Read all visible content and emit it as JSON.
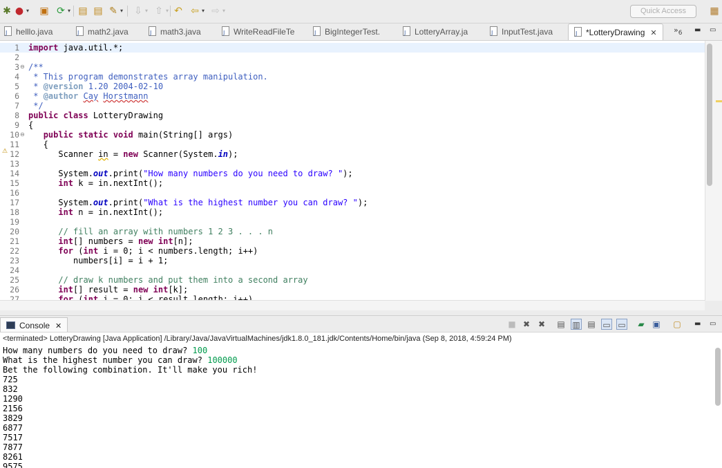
{
  "toolbar": {
    "icons": [
      "debug-icon",
      "run-icon",
      "new-package-icon",
      "coverage-icon",
      "open-type-icon",
      "open-task-icon",
      "annotation-icon",
      "next-annotation-icon",
      "previous-annotation-icon",
      "back-icon",
      "forward-icon"
    ],
    "quick_access_placeholder": "Quick Access",
    "perspective_icon": "java-perspective-icon"
  },
  "tabs": [
    {
      "label": "helllo.java"
    },
    {
      "label": "math2.java"
    },
    {
      "label": "math3.java"
    },
    {
      "label": "WriteReadFileTe"
    },
    {
      "label": "BigIntegerTest."
    },
    {
      "label": "LotteryArray.ja"
    },
    {
      "label": "InputTest.java"
    },
    {
      "label": "*LotteryDrawing",
      "active": true
    }
  ],
  "tabs_overflow": "»",
  "tabs_overflow_count": "6",
  "editor": {
    "lines": [
      {
        "n": "1",
        "html": "<span class=\"kw\">import</span> java.util.*;"
      },
      {
        "n": "2",
        "html": ""
      },
      {
        "n": "3",
        "html": "<span class=\"jd\">/**</span>"
      },
      {
        "n": "4",
        "html": "<span class=\"jd\"> * This program demonstrates array manipulation.</span>"
      },
      {
        "n": "5",
        "html": "<span class=\"jd\"> * </span><span class=\"jdtag\">@version</span><span class=\"jd\"> 1.20 2004-02-10</span>"
      },
      {
        "n": "6",
        "html": "<span class=\"jd\"> * </span><span class=\"jdtag\">@author</span><span class=\"jd\"> <span class=\"sqr\">Cay</span> <span class=\"sqr\">Horstmann</span></span>"
      },
      {
        "n": "7",
        "html": "<span class=\"jd\"> */</span>"
      },
      {
        "n": "8",
        "html": "<span class=\"kw\">public class</span> LotteryDrawing"
      },
      {
        "n": "9",
        "html": "{"
      },
      {
        "n": "10",
        "html": "   <span class=\"kw\">public static void</span> main(String[] args)"
      },
      {
        "n": "11",
        "html": "   {"
      },
      {
        "n": "12",
        "html": "      Scanner <span class=\"sq\">in</span> = <span class=\"kw\">new</span> Scanner(System.<span class=\"fld\">in</span>);"
      },
      {
        "n": "13",
        "html": ""
      },
      {
        "n": "14",
        "html": "      System.<span class=\"fld\">out</span>.print(<span class=\"str\">\"How many numbers do you need to draw? \"</span>);"
      },
      {
        "n": "15",
        "html": "      <span class=\"kw\">int</span> k = in.nextInt();"
      },
      {
        "n": "16",
        "html": ""
      },
      {
        "n": "17",
        "html": "      System.<span class=\"fld\">out</span>.print(<span class=\"str\">\"What is the highest number you can draw? \"</span>);"
      },
      {
        "n": "18",
        "html": "      <span class=\"kw\">int</span> n = in.nextInt();"
      },
      {
        "n": "19",
        "html": ""
      },
      {
        "n": "20",
        "html": "      <span class=\"cm\">// fill an array with numbers 1 2 3 . . . n</span>"
      },
      {
        "n": "21",
        "html": "      <span class=\"kw\">int</span>[] numbers = <span class=\"kw\">new int</span>[n];"
      },
      {
        "n": "22",
        "html": "      <span class=\"kw\">for</span> (<span class=\"kw\">int</span> i = 0; i &lt; numbers.length; i++)"
      },
      {
        "n": "23",
        "html": "         numbers[i] = i + 1;"
      },
      {
        "n": "24",
        "html": ""
      },
      {
        "n": "25",
        "html": "      <span class=\"cm\">// draw k numbers and put them into a second array</span>"
      },
      {
        "n": "26",
        "html": "      <span class=\"kw\">int</span>[] result = <span class=\"kw\">new int</span>[k];"
      },
      {
        "n": "27",
        "html": "      <span class=\"kw\">for</span> (<span class=\"kw\">int</span> i = 0; i &lt; result.length; i++)"
      }
    ],
    "fold_lines": [
      "3",
      "10"
    ],
    "warning_line": "12"
  },
  "console": {
    "tab_label": "Console",
    "tool_icons": [
      "terminate-icon",
      "remove-launch-icon",
      "remove-all-terminated-icon",
      "clear-console-icon",
      "scroll-lock-icon",
      "word-wrap-icon",
      "show-on-stdout-icon",
      "show-on-stderr-icon",
      "pin-console-icon",
      "display-console-icon",
      "open-console-icon"
    ],
    "terminated": "<terminated> LotteryDrawing [Java Application] /Library/Java/JavaVirtualMachines/jdk1.8.0_181.jdk/Contents/Home/bin/java (Sep 8, 2018, 4:59:24 PM)",
    "lines": [
      {
        "text": "How many numbers do you need to draw? ",
        "input": "100"
      },
      {
        "text": "What is the highest number you can draw? ",
        "input": "100000"
      },
      {
        "text": "Bet the following combination. It'll make you rich!",
        "input": ""
      },
      {
        "text": "725",
        "input": ""
      },
      {
        "text": "832",
        "input": ""
      },
      {
        "text": "1290",
        "input": ""
      },
      {
        "text": "2156",
        "input": ""
      },
      {
        "text": "3829",
        "input": ""
      },
      {
        "text": "6877",
        "input": ""
      },
      {
        "text": "7517",
        "input": ""
      },
      {
        "text": "7877",
        "input": ""
      },
      {
        "text": "8261",
        "input": ""
      },
      {
        "text": "9575",
        "input": ""
      }
    ]
  },
  "colors": {
    "keyword": "#7f0055",
    "comment": "#3f7f5f",
    "javadoc": "#3f5fbf",
    "string": "#2a00ff",
    "console_input": "#009a4c"
  }
}
